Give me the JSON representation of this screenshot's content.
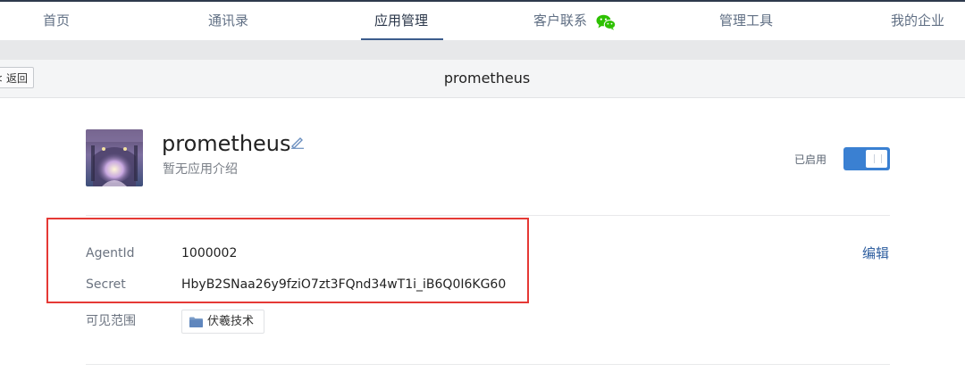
{
  "nav": {
    "items": [
      {
        "label": "首页"
      },
      {
        "label": "通讯录"
      },
      {
        "label": "应用管理"
      },
      {
        "label": "客户联系"
      },
      {
        "label": "管理工具"
      },
      {
        "label": "我的企业"
      }
    ],
    "active_index": 2
  },
  "header": {
    "back_label": "< 返回",
    "title": "prometheus"
  },
  "app": {
    "name": "prometheus",
    "description": "暂无应用介绍",
    "status_label": "已启用",
    "enabled": true
  },
  "details": {
    "agentid_label": "AgentId",
    "agentid_value": "1000002",
    "secret_label": "Secret",
    "secret_value": "HbyB2SNaa26y9fziO7zt3FQnd34wT1i_iB6Q0I6KG60",
    "edit_label": "编辑",
    "scope_label": "可见范围",
    "scope_department": "伏羲技术"
  },
  "colors": {
    "accent": "#3a80d2",
    "nav_active_underline": "#3b5c8c",
    "highlight_box": "#e53935",
    "link": "#2f5fa0",
    "wechat_green": "#2dc100"
  },
  "icons": {
    "wechat": "wechat-icon",
    "edit": "pencil-icon",
    "folder": "folder-icon"
  }
}
